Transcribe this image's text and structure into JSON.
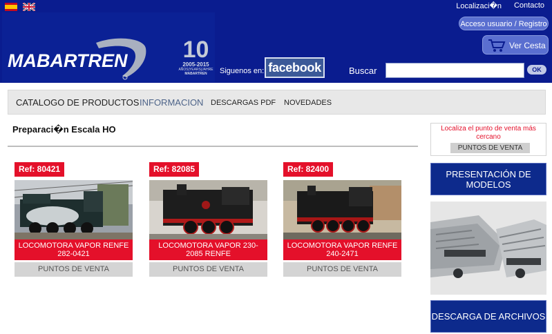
{
  "header": {
    "top_links": {
      "location": "Localizaci�n",
      "contact": "Contacto"
    },
    "login_label": "Acceso usuario / Registro",
    "cart_label": "Ver Cesta",
    "logo_text": "MABARTREN",
    "anniversary": {
      "number": "10",
      "years": "2005-2015",
      "caption": "AÑOS|YEARS|JAHRE",
      "brand": "MABARTREN"
    },
    "follow_label": "Siguenos en:",
    "facebook_label": "facebook",
    "search_label": "Buscar",
    "search_value": "",
    "search_button": "OK"
  },
  "nav": {
    "items": [
      "CATALOGO DE PRODUCTOS",
      "INFORMACION",
      "DESCARGAS PDF",
      "NOVEDADES"
    ],
    "active": "INFORMACION"
  },
  "main": {
    "title": "Preparaci�n Escala HO",
    "products": [
      {
        "ref": "Ref: 80421",
        "name": "LOCOMOTORA VAPOR RENFE 282-0421",
        "button": "PUNTOS DE VENTA"
      },
      {
        "ref": "Ref: 82085",
        "name": "LOCOMOTORA VAPOR 230-2085 RENFE",
        "button": "PUNTOS DE VENTA"
      },
      {
        "ref": "Ref: 82400",
        "name": "LOCOMOTORA VAPOR RENFE 240-2471",
        "button": "PUNTOS DE VENTA"
      }
    ]
  },
  "sidebar": {
    "locator_text": "Localiza el punto de venta más cercano",
    "locator_button": "PUNTOS DE VENTA",
    "presentacion": "PRESENTACIÓN DE MODELOS",
    "descarga": "DESCARGA DE ARCHIVOS"
  },
  "colors": {
    "header_blue": "#0a1c8f",
    "accent_red": "#e4102a",
    "nav_gray": "#e8e8e8",
    "sidebar_blue": "#0d2a8c"
  }
}
